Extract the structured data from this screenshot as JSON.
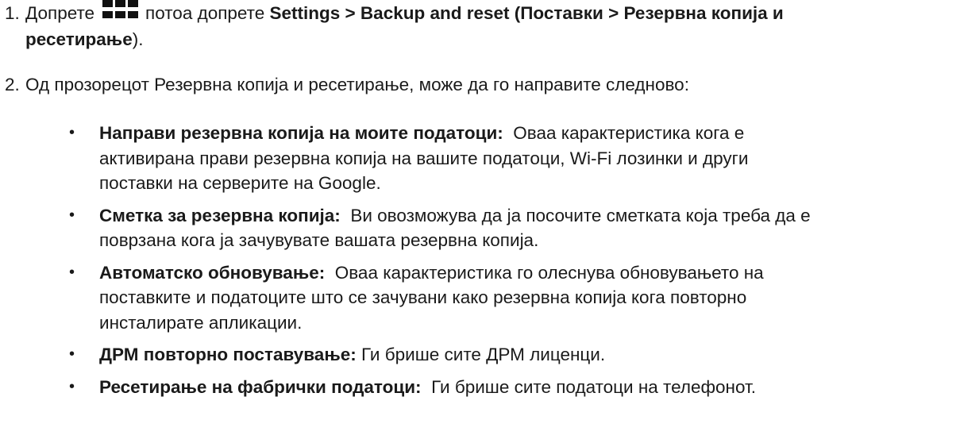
{
  "step1": {
    "number": "1.",
    "lead": "Допрете",
    "icon": "apps-grid-icon",
    "middle": "потоа допрете",
    "bold_path": "Settings > Backup and reset (Поставки > Резервна копија и",
    "bold_path_cont": "ресетирање",
    "end": ")."
  },
  "step2": {
    "number": "2.",
    "text": "Од прозорецот Резервна копија и ресетирање, може да го направите следново:"
  },
  "bullets": [
    {
      "bullet": "•",
      "term": "Направи резервна копија на моите податоци:",
      "lines": [
        "Оваа карактеристика кога е",
        "активирана прави резервна копија на вашите податоци, Wi-Fi лозинки и други",
        "поставки на серверите на Google."
      ]
    },
    {
      "bullet": "•",
      "term": "Сметка за резервна копија:",
      "lines": [
        "Ви овозможува да ја посочите сметката која треба да е",
        "поврзана кога ја зачувувате вашата резервна копија."
      ]
    },
    {
      "bullet": "•",
      "term": "Автоматско обновување:",
      "lines": [
        "Оваа карактеристика го олеснува обновувањето на",
        "поставките и податоците што се зачувани како резервна копија кога повторно",
        "инсталирате апликации."
      ]
    },
    {
      "bullet": "•",
      "term": "ДРМ повторно поставување:",
      "lines": [
        "Ги брише сите ДРМ лиценци."
      ]
    },
    {
      "bullet": "•",
      "term": "Ресетирање на фабрички податоци:",
      "lines": [
        "Ги брише сите податоци на телефонот."
      ]
    }
  ]
}
